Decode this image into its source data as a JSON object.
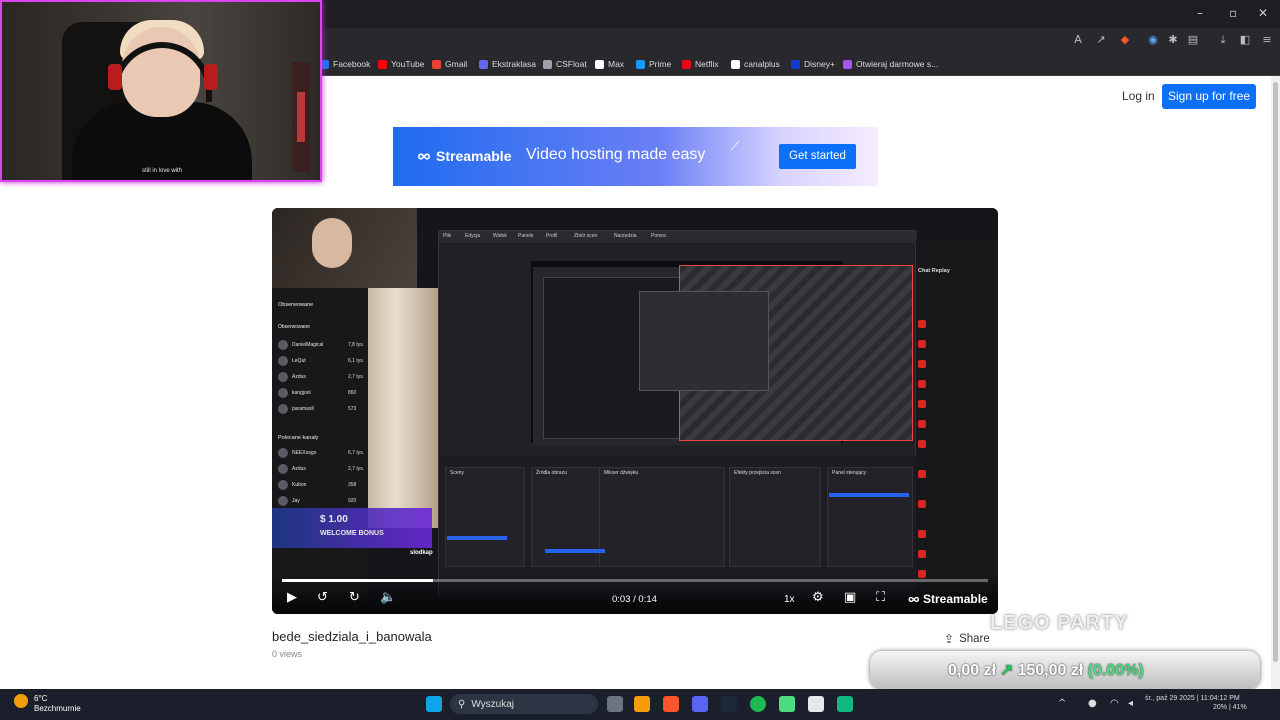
{
  "browser": {
    "bookmarks": [
      {
        "label": "Facebook",
        "color": "#1877f2"
      },
      {
        "label": "YouTube",
        "color": "#ff0000"
      },
      {
        "label": "Gmail",
        "color": "#ea4335"
      },
      {
        "label": "Ekstraklasa",
        "color": "#6366f1"
      },
      {
        "label": "CSFloat",
        "color": "#9ca3af"
      },
      {
        "label": "Max",
        "color": "#ffffff"
      },
      {
        "label": "Prime",
        "color": "#1a98ff"
      },
      {
        "label": "Netflix",
        "color": "#e50914"
      },
      {
        "label": "canalplus",
        "color": "#ffffff"
      },
      {
        "label": "Disney+",
        "color": "#113ccf"
      },
      {
        "label": "Otwieraj darmowe s...",
        "color": "#a855f7"
      }
    ]
  },
  "webcam": {
    "shirt_text": "still in love with"
  },
  "header": {
    "login_label": "Log in",
    "signup_label": "Sign up for free"
  },
  "banner": {
    "brand": "Streamable",
    "tagline": "Video hosting made easy",
    "cta_label": "Get started"
  },
  "video": {
    "time_display": "0:03 / 0:14",
    "progress_fraction": 0.214,
    "speed_label": "1x",
    "brand_label": "Streamable",
    "title": "bede_siedziala_i_banowala",
    "views": "0 views",
    "share_label": "Share",
    "inner": {
      "side_header_followed": "Obserwowane",
      "side_header_recommended": "Polecane kanały",
      "followed_channels": [
        {
          "name": "DanielMagical",
          "count": "7,8 tys."
        },
        {
          "name": "LeQut",
          "count": "6,1 tys."
        },
        {
          "name": "Azdus",
          "count": "2,7 tys."
        },
        {
          "name": "kangjool",
          "count": "860"
        },
        {
          "name": "paramaxll",
          "count": "573"
        }
      ],
      "recommended_channels": [
        {
          "name": "NEEXosgo",
          "count": "6,7 tys."
        },
        {
          "name": "Azdus",
          "count": "2,7 tys."
        },
        {
          "name": "Kubon",
          "count": "358"
        },
        {
          "name": "Jay",
          "count": "920"
        }
      ],
      "obs_menu": [
        "Plik",
        "Edycja",
        "Widok",
        "Panele",
        "Profil",
        "Zbiór scen",
        "Narzędzia",
        "Pomoc"
      ],
      "obs_panels": [
        "Sceny",
        "Źródła obrazu",
        "Mikser dźwięku",
        "Efekty przejścia scen",
        "Panel sterujący"
      ],
      "chat_title": "Chat Replay",
      "promo_text": "$ 1.00",
      "promo_sub": "WELCOME BONUS",
      "chat_user": "slodkap"
    }
  },
  "overlay": {
    "lego": "LEGO PARTY",
    "money_left": "0,00 zł",
    "money_right": "150,00 zł",
    "money_pct": "(0.00%)"
  },
  "taskbar": {
    "temp": "6°C",
    "weather": "Bezchmurnie",
    "search_label": "Wyszukaj",
    "date": "śr., paź 29 2025",
    "time": "11:04:12 PM",
    "battery": "20% | 41%"
  }
}
